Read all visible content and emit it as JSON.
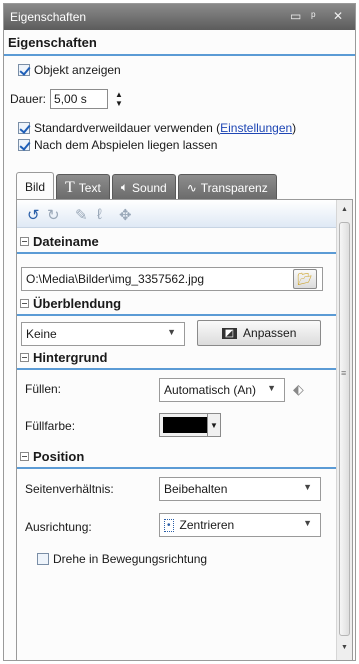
{
  "window": {
    "title": "Eigenschaften",
    "controls": [
      "▭",
      "ᵖ",
      "x"
    ]
  },
  "panel": {
    "heading": "Eigenschaften",
    "show_object": {
      "label": "Objekt anzeigen",
      "checked": true
    },
    "duration": {
      "label": "Dauer:",
      "value": "5,00 s"
    },
    "default_duration": {
      "label": "Standardverweildauer verwenden (",
      "link": "Einstellungen",
      "suffix": ")",
      "checked": true
    },
    "leave_after_play": {
      "label": "Nach dem Abspielen liegen lassen",
      "checked": true
    }
  },
  "tabs": [
    {
      "label": "Bild",
      "icon": "",
      "active": true
    },
    {
      "label": "Text",
      "icon": "T",
      "active": false
    },
    {
      "label": "Sound",
      "icon": "speaker-icon",
      "active": false
    },
    {
      "label": "Transparenz",
      "icon": "transparency-icon",
      "active": false
    }
  ],
  "toolbar": {
    "icons": [
      "rotate-left-icon",
      "rotate-right-icon",
      "pencil-icon",
      "path-icon",
      "move-icon"
    ]
  },
  "sections": {
    "dateiname": {
      "title": "Dateiname",
      "path": "O:\\Media\\Bilder\\img_3357562.jpg"
    },
    "ueberblendung": {
      "title": "Überblendung",
      "selected": "Keine",
      "button": "Anpassen"
    },
    "hintergrund": {
      "title": "Hintergrund",
      "fill_label": "Füllen:",
      "fill_value": "Automatisch (An)",
      "fillcolor_label": "Füllfarbe:",
      "fillcolor": "#000000"
    },
    "position": {
      "title": "Position",
      "ratio_label": "Seitenverhältnis:",
      "ratio_value": "Beibehalten",
      "align_label": "Ausrichtung:",
      "align_value": "Zentrieren",
      "rotate": {
        "label": "Drehe in Bewegungsrichtung",
        "checked": false
      }
    }
  },
  "colors": {
    "accent": "#5b9bd5",
    "link": "#1e46b4",
    "titlebar": "#6e6e6e"
  }
}
